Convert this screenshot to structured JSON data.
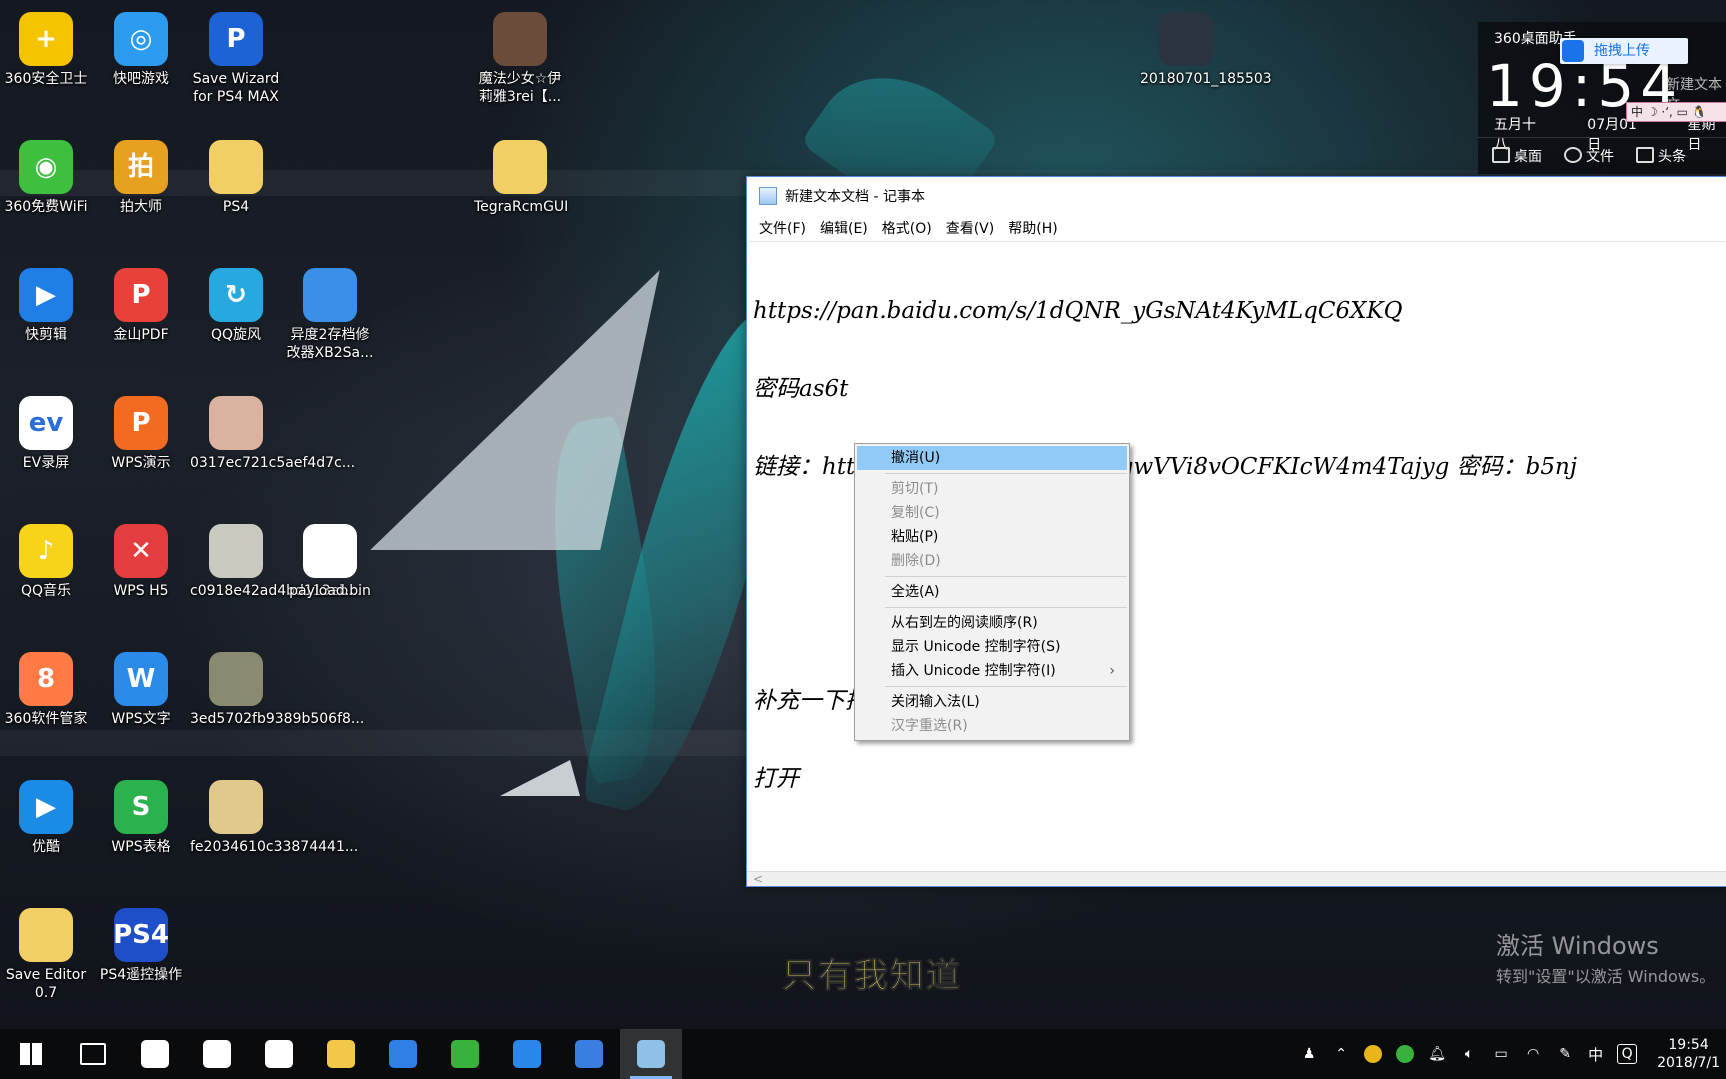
{
  "desktop": {
    "icons": [
      {
        "label": "360安全卫士",
        "color": "#f5c400",
        "glyph": "+"
      },
      {
        "label": "快吧游戏",
        "color": "#2d9cf0",
        "glyph": "◎"
      },
      {
        "label": "Save Wizard for PS4 MAX",
        "color": "#1e63d6",
        "glyph": "P"
      },
      {
        "label": "魔法少女☆伊莉雅3rei【...",
        "color": "#6b4c3a",
        "glyph": ""
      },
      {
        "label": "20180701_185503",
        "color": "#2a3440",
        "glyph": ""
      },
      {
        "label": "360免费WiFi",
        "color": "#3fbf3f",
        "glyph": "◉"
      },
      {
        "label": "拍大师",
        "color": "#e8a020",
        "glyph": "拍"
      },
      {
        "label": "PS4",
        "color": "#f2cf64",
        "glyph": ""
      },
      {
        "label": "TegraRcmGUI",
        "color": "#f2cf64",
        "glyph": ""
      },
      {
        "label": "快剪辑",
        "color": "#1f7fe6",
        "glyph": "▶"
      },
      {
        "label": "金山PDF",
        "color": "#e8413a",
        "glyph": "P"
      },
      {
        "label": "QQ旋风",
        "color": "#27a9e0",
        "glyph": "↻"
      },
      {
        "label": "异度2存档修改器XB2Sa...",
        "color": "#3a8fe8",
        "glyph": ""
      },
      {
        "label": "EV录屏",
        "color": "#ffffff",
        "glyph": "ev"
      },
      {
        "label": "WPS演示",
        "color": "#f26b21",
        "glyph": "P"
      },
      {
        "label": "0317ec721c5aef4d7c...",
        "color": "#d9b3a0",
        "glyph": ""
      },
      {
        "label": "QQ音乐",
        "color": "#f7d31a",
        "glyph": "♪"
      },
      {
        "label": "WPS H5",
        "color": "#e33d3d",
        "glyph": "✕"
      },
      {
        "label": "c0918e42ad4bd113eb...",
        "color": "#c9c9c0",
        "glyph": ""
      },
      {
        "label": "payload.bin",
        "color": "#ffffff",
        "glyph": ""
      },
      {
        "label": "360软件管家",
        "color": "#ff7a45",
        "glyph": "8"
      },
      {
        "label": "WPS文字",
        "color": "#2a8be8",
        "glyph": "W"
      },
      {
        "label": "3ed5702fb9389b506f8...",
        "color": "#8a8a70",
        "glyph": ""
      },
      {
        "label": "优酷",
        "color": "#1b8ce6",
        "glyph": "▶"
      },
      {
        "label": "WPS表格",
        "color": "#2bb24c",
        "glyph": "S"
      },
      {
        "label": "fe2034610c33874441...",
        "color": "#e0c98a",
        "glyph": ""
      },
      {
        "label": "Save Editor 0.7",
        "color": "#f2cf64",
        "glyph": ""
      },
      {
        "label": "PS4遥控操作",
        "color": "#1e4fc9",
        "glyph": "PS4"
      }
    ]
  },
  "notepad": {
    "title": "新建文本文档 - 记事本",
    "menu": [
      "文件(F)",
      "编辑(E)",
      "格式(O)",
      "查看(V)",
      "帮助(H)"
    ],
    "lines": [
      "https://pan.baidu.com/s/1dQNR_yGsNAt4KyMLqC6XKQ",
      "密码as6t",
      "链接：https://pan.baidu.com/s/1gwVVi8vOCFKIcW4m4Tajyg 密码：b5nj",
      "",
      "",
      "补充一下把payload.bin放在桌面上",
      "打开"
    ],
    "hscroll_arrow": "<"
  },
  "context_menu": {
    "items": [
      {
        "label": "撤消(U)",
        "state": "hover"
      },
      {
        "sep": true
      },
      {
        "label": "剪切(T)",
        "state": "disabled"
      },
      {
        "label": "复制(C)",
        "state": "disabled"
      },
      {
        "label": "粘贴(P)",
        "state": "normal"
      },
      {
        "label": "删除(D)",
        "state": "disabled"
      },
      {
        "sep": true
      },
      {
        "label": "全选(A)",
        "state": "normal"
      },
      {
        "sep": true
      },
      {
        "label": "从右到左的阅读顺序(R)",
        "state": "normal"
      },
      {
        "label": "显示 Unicode 控制字符(S)",
        "state": "normal"
      },
      {
        "label": "插入 Unicode 控制字符(I)",
        "state": "normal",
        "submenu": "›"
      },
      {
        "sep": true
      },
      {
        "label": "关闭输入法(L)",
        "state": "normal"
      },
      {
        "label": "汉字重选(R)",
        "state": "disabled"
      }
    ]
  },
  "widget": {
    "title": "360桌面助手",
    "time": "19:54",
    "dates": [
      "五月十八",
      "07月01日",
      "星期日"
    ],
    "bar": [
      "桌面",
      "文件",
      "头条"
    ],
    "upload_label": "拖拽上传",
    "ghost_file": "新建文本文",
    "ime_text": "中 ☽ ·ʻ, ▭ 🐧"
  },
  "activation": {
    "line1": "激活 Windows",
    "line2": "转到\"设置\"以激活 Windows。"
  },
  "subtitle": "只有我知道",
  "taskbar": {
    "apps": [
      {
        "name": "windows-start",
        "color": "#ffffff"
      },
      {
        "name": "task-view",
        "color": "#ffffff"
      },
      {
        "name": "pinwheel",
        "color": "#ffffff"
      },
      {
        "name": "internet-explorer",
        "color": "#ffffff"
      },
      {
        "name": "mail",
        "color": "#ffffff"
      },
      {
        "name": "file-explorer",
        "color": "#f2c84b"
      },
      {
        "name": "baidu-netdisk",
        "color": "#2f7fe6"
      },
      {
        "name": "360-browser",
        "color": "#38b23a"
      },
      {
        "name": "kuaijianji",
        "color": "#2d87ea"
      },
      {
        "name": "archive",
        "color": "#3a7fe0"
      },
      {
        "name": "notepad",
        "color": "#8fc0e6"
      }
    ],
    "tray_ime": "中",
    "clock_time": "19:54",
    "clock_date": "2018/7/1"
  }
}
